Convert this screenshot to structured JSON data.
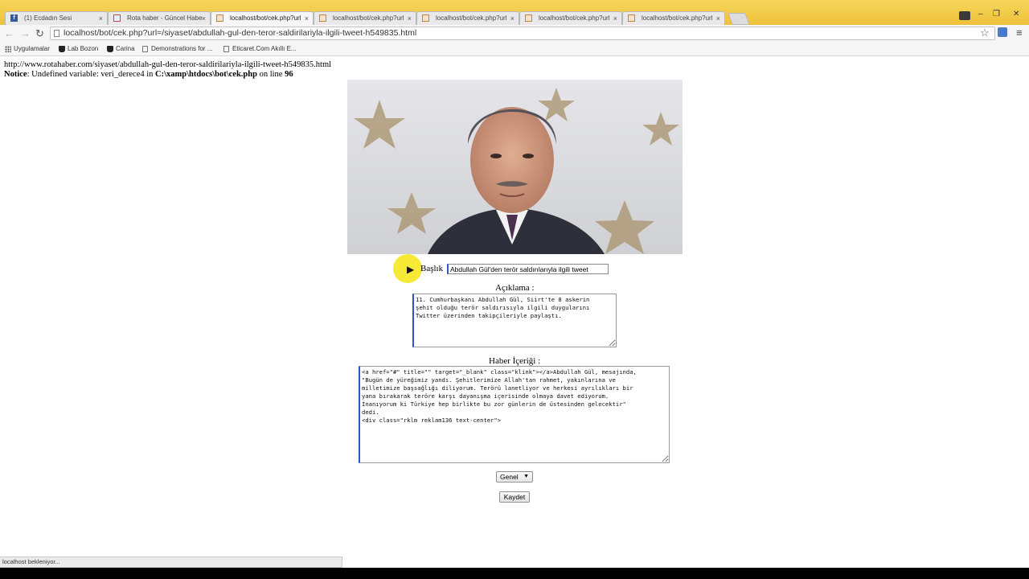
{
  "tabs": [
    {
      "label": "(1) Ecdadın Sesi",
      "icon": "facebook-icon",
      "close": "×"
    },
    {
      "label": "Rota haber - Güncel Habe",
      "icon": "rota-favicon-icon",
      "close": "×"
    },
    {
      "label": "localhost/bot/cek.php?url",
      "icon": "page-favicon-icon",
      "close": "×"
    },
    {
      "label": "localhost/bot/cek.php?url",
      "icon": "page-favicon-icon",
      "close": "×"
    },
    {
      "label": "localhost/bot/cek.php?url",
      "icon": "page-favicon-icon",
      "close": "×"
    },
    {
      "label": "localhost/bot/cek.php?url",
      "icon": "page-favicon-icon",
      "close": "×"
    },
    {
      "label": "localhost/bot/cek.php?url",
      "icon": "page-favicon-icon",
      "close": "×"
    }
  ],
  "active_tab_index": 2,
  "window_controls": {
    "minimize": "–",
    "restore": "❐",
    "close": "✕"
  },
  "toolbar": {
    "back": "←",
    "forward": "→",
    "reload": "↻",
    "address": "localhost/bot/cek.php?url=/siyaset/abdullah-gul-den-teror-saldirilariyla-ilgili-tweet-h549835.html",
    "star": "☆",
    "menu": "≡"
  },
  "bookmarks": [
    {
      "label": "Uygulamalar",
      "icon": "apps-grid-icon"
    },
    {
      "label": "Lab Bozon",
      "icon": "bookmark-favicon-icon"
    },
    {
      "label": "Carina",
      "icon": "bookmark-favicon-icon"
    },
    {
      "label": "Demonstrations for ...",
      "icon": "page-icon"
    },
    {
      "label": "Eticaret.Com Akıllı E...",
      "icon": "page-icon"
    }
  ],
  "page": {
    "source_url": "http://www.rotahaber.com/siyaset/abdullah-gul-den-teror-saldirilariyla-ilgili-tweet-h549835.html",
    "notice": {
      "prefix": "Notice",
      "message": ": Undefined variable: veri_derece4 in ",
      "file": "C:\\xamp\\htdocs\\bot\\cek.php",
      "line_text": " on line ",
      "line": "96"
    },
    "title_label": "Başlık",
    "title_value": "Abdullah Gül'den terör saldırılarıyla ilgili tweet",
    "description_label": "Açıklama :",
    "description_value": "11. Cumhurbaşkanı Abdullah Gül, Siirt'te 8 askerin\nşehit olduğu terör saldırısıyla ilgili duygularını\nTwitter üzerinden takipçileriyle paylaştı.",
    "content_label": "Haber İçeriği :",
    "content_value": "<a href=\"#\" title=\"\" target=\"_blank\" class=\"klink\"></a>Abdullah Gül, mesajında,\n\"Bugün de yüreğimiz yandı. Şehitlerimize Allah'tan rahmet, yakınlarına ve\nmilletimize başsağlığı diliyorum. Terörü lanetliyor ve herkesi ayrılıkları bir\nyana bırakarak teröre karşı dayanışma içerisinde olmaya davet ediyorum.\nİnanıyorum ki Türkiye hep birlikte bu zor günlerin de üstesinden gelecektir\"\ndedi.\n<div class=\"rklm reklam136 text-center\">",
    "category_selected": "Genel",
    "save_button": "Kaydet"
  },
  "status_text": "localhost bekleniyor..."
}
